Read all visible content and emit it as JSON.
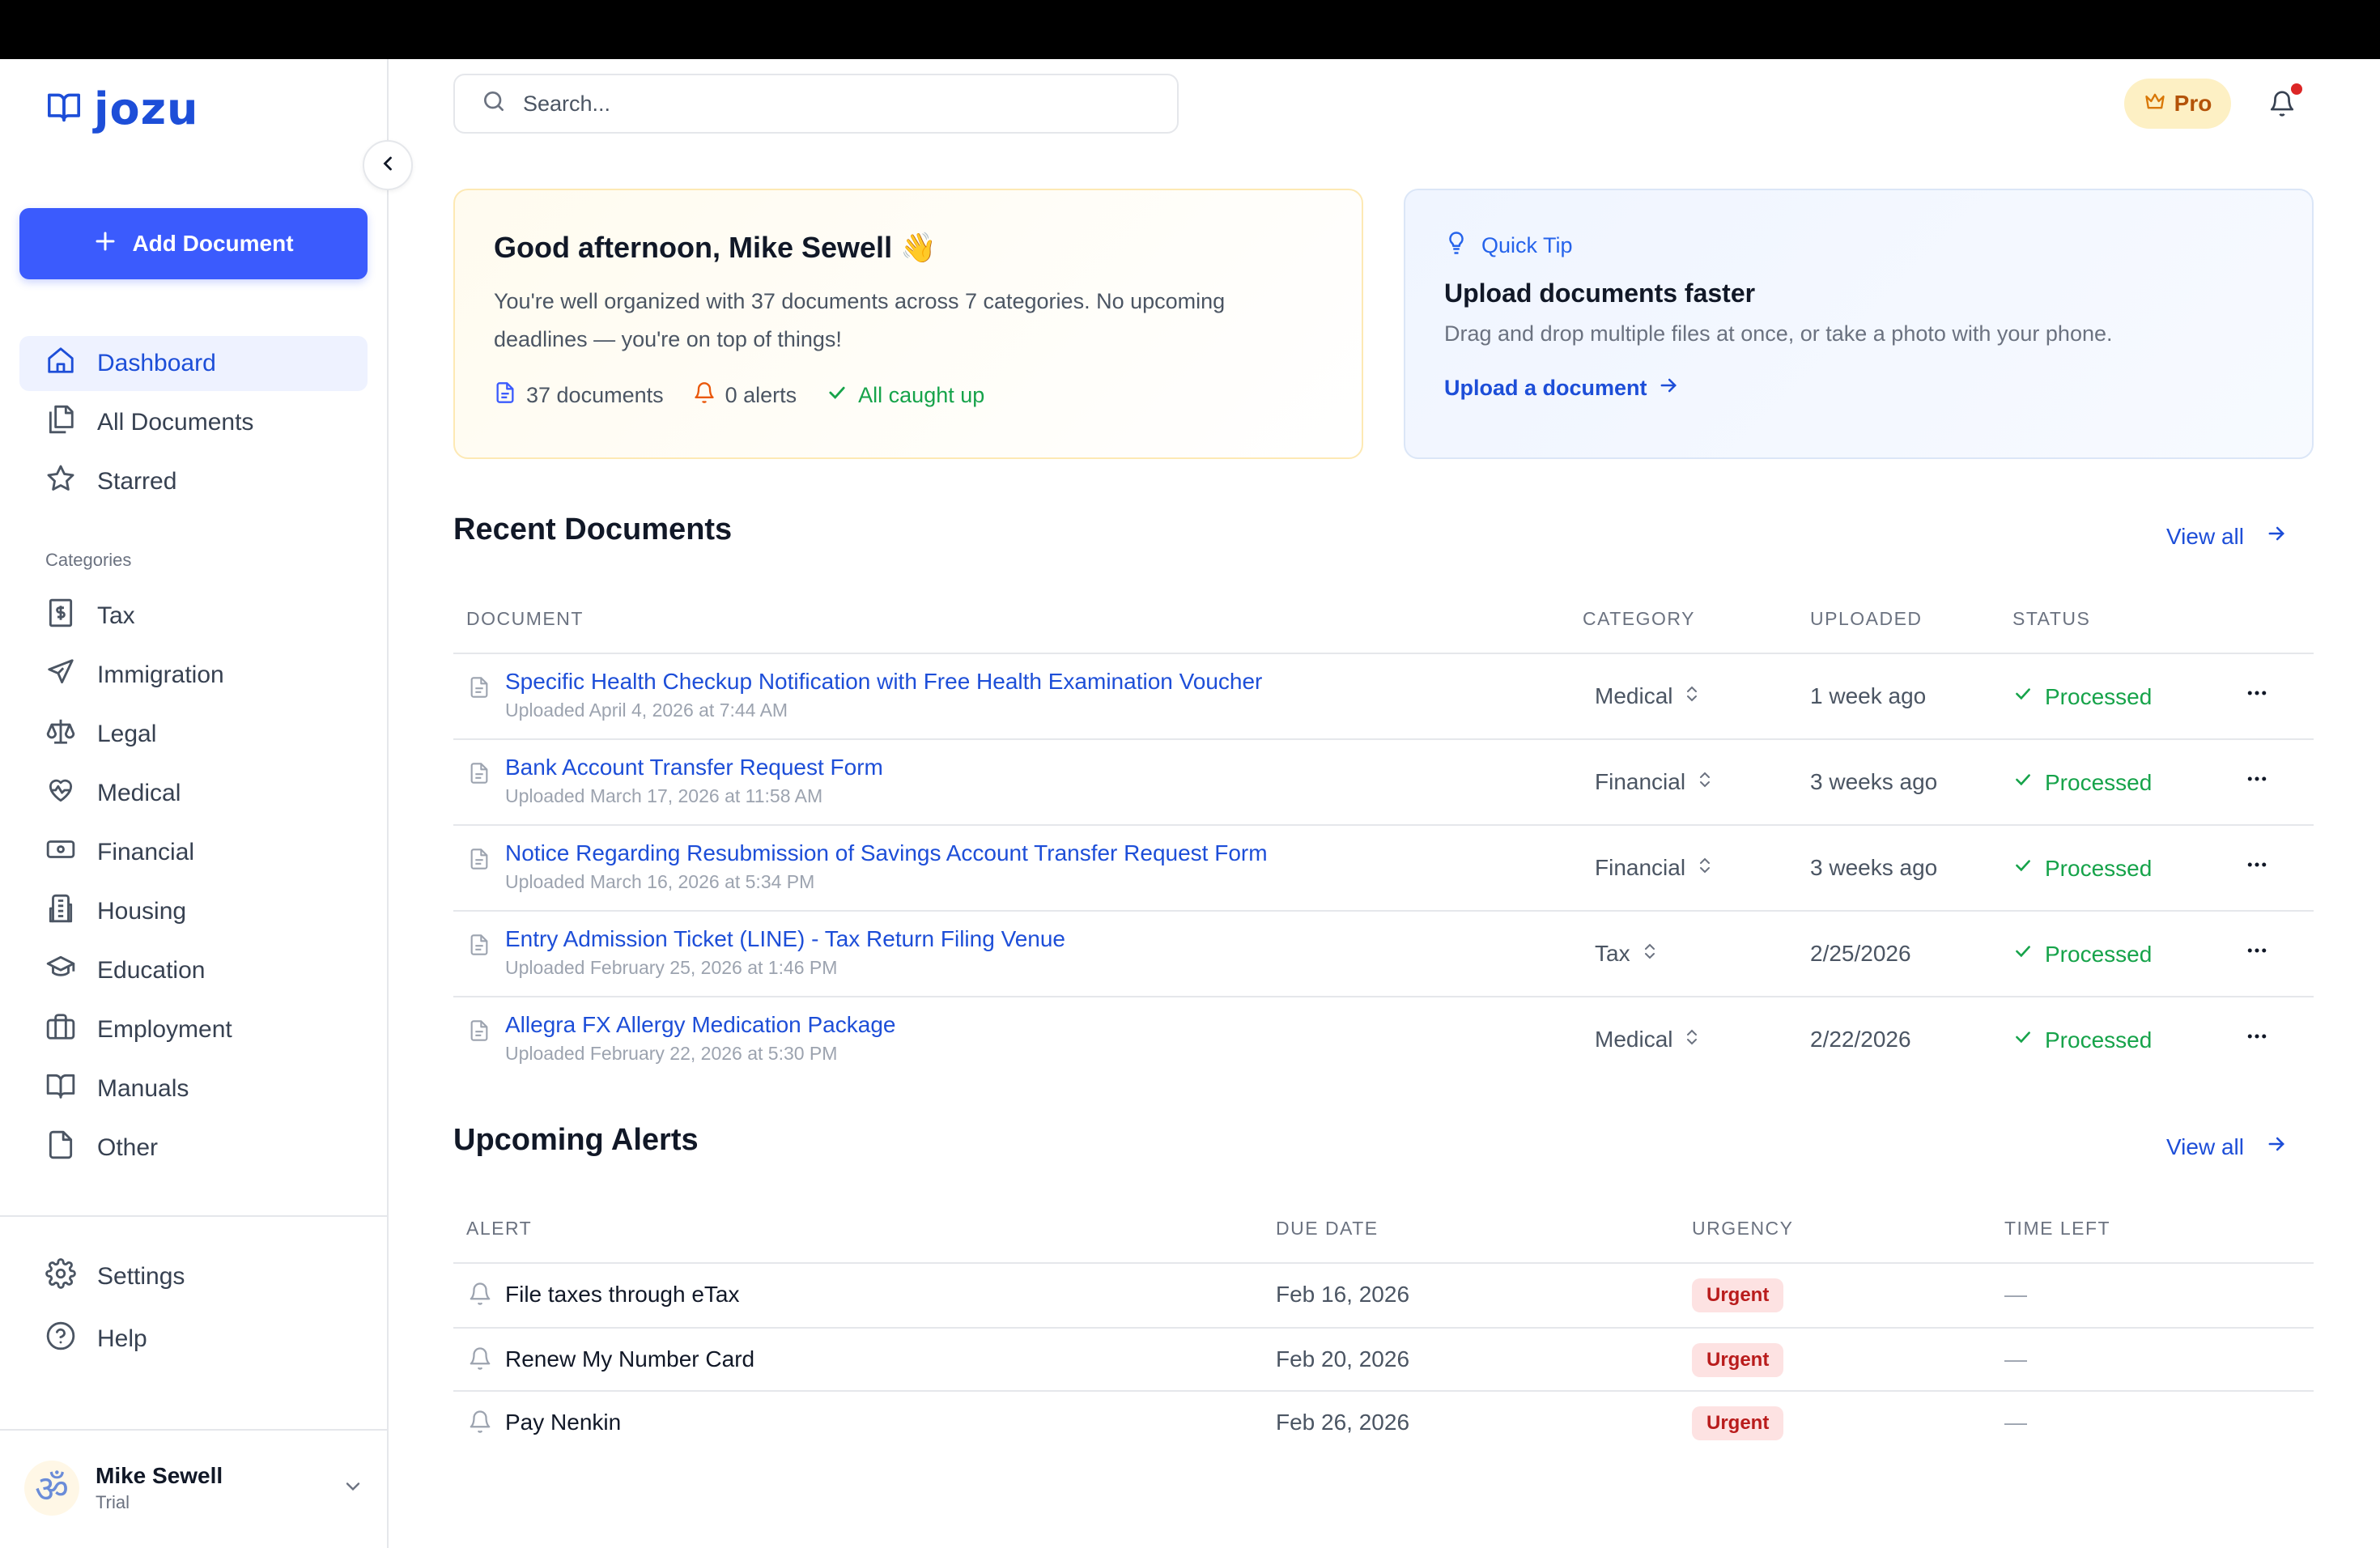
{
  "brand": {
    "name": "jozu",
    "accent": "#3b5bfd",
    "link": "#1d4ed8"
  },
  "sidebar": {
    "add_label": "Add Document",
    "main_items": [
      {
        "label": "Dashboard",
        "icon": "home-icon"
      },
      {
        "label": "All Documents",
        "icon": "documents-icon"
      },
      {
        "label": "Starred",
        "icon": "star-icon"
      }
    ],
    "categories_label": "Categories",
    "categories": [
      {
        "label": "Tax",
        "icon": "dollar-receipt-icon"
      },
      {
        "label": "Immigration",
        "icon": "plane-icon"
      },
      {
        "label": "Legal",
        "icon": "scale-icon"
      },
      {
        "label": "Medical",
        "icon": "heart-pulse-icon"
      },
      {
        "label": "Financial",
        "icon": "banknote-icon"
      },
      {
        "label": "Housing",
        "icon": "building-icon"
      },
      {
        "label": "Education",
        "icon": "graduation-cap-icon"
      },
      {
        "label": "Employment",
        "icon": "briefcase-icon"
      },
      {
        "label": "Manuals",
        "icon": "book-icon"
      },
      {
        "label": "Other",
        "icon": "file-icon"
      }
    ],
    "bottom_items": [
      {
        "label": "Settings",
        "icon": "gear-icon"
      },
      {
        "label": "Help",
        "icon": "help-circle-icon"
      }
    ],
    "user": {
      "name": "Mike Sewell",
      "plan": "Trial",
      "avatar_glyph": "ॐ"
    }
  },
  "header": {
    "search_placeholder": "Search...",
    "pro_label": "Pro"
  },
  "greeting": {
    "title": "Good afternoon, Mike Sewell",
    "emoji": "👋",
    "text": "You're well organized with 37 documents across 7 categories. No upcoming deadlines — you're on top of things!",
    "stats": {
      "documents": "37 documents",
      "alerts": "0 alerts",
      "status": "All caught up"
    }
  },
  "tip": {
    "label": "Quick Tip",
    "title": "Upload documents faster",
    "text": "Drag and drop multiple files at once, or take a photo with your phone.",
    "link": "Upload a document"
  },
  "recent": {
    "title": "Recent Documents",
    "view_all": "View all",
    "columns": {
      "document": "DOCUMENT",
      "category": "CATEGORY",
      "uploaded": "UPLOADED",
      "status": "STATUS"
    },
    "rows": [
      {
        "title": "Specific Health Checkup Notification with Free Health Examination Voucher",
        "sub": "Uploaded April 4, 2026 at 7:44 AM",
        "category": "Medical",
        "uploaded": "1 week ago",
        "status": "Processed"
      },
      {
        "title": "Bank Account Transfer Request Form",
        "sub": "Uploaded March 17, 2026 at 11:58 AM",
        "category": "Financial",
        "uploaded": "3 weeks ago",
        "status": "Processed"
      },
      {
        "title": "Notice Regarding Resubmission of Savings Account Transfer Request Form",
        "sub": "Uploaded March 16, 2026 at 5:34 PM",
        "category": "Financial",
        "uploaded": "3 weeks ago",
        "status": "Processed"
      },
      {
        "title": "Entry Admission Ticket (LINE) - Tax Return Filing Venue",
        "sub": "Uploaded February 25, 2026 at 1:46 PM",
        "category": "Tax",
        "uploaded": "2/25/2026",
        "status": "Processed"
      },
      {
        "title": "Allegra FX Allergy Medication Package",
        "sub": "Uploaded February 22, 2026 at 5:30 PM",
        "category": "Medical",
        "uploaded": "2/22/2026",
        "status": "Processed"
      }
    ]
  },
  "alerts": {
    "title": "Upcoming Alerts",
    "view_all": "View all",
    "columns": {
      "alert": "ALERT",
      "due": "DUE DATE",
      "urgency": "URGENCY",
      "time_left": "TIME LEFT"
    },
    "rows": [
      {
        "name": "File taxes through eTax",
        "due": "Feb 16, 2026",
        "urgency": "Urgent",
        "time_left": "—"
      },
      {
        "name": "Renew My Number Card",
        "due": "Feb 20, 2026",
        "urgency": "Urgent",
        "time_left": "—"
      },
      {
        "name": "Pay Nenkin",
        "due": "Feb 26, 2026",
        "urgency": "Urgent",
        "time_left": "—"
      }
    ]
  }
}
